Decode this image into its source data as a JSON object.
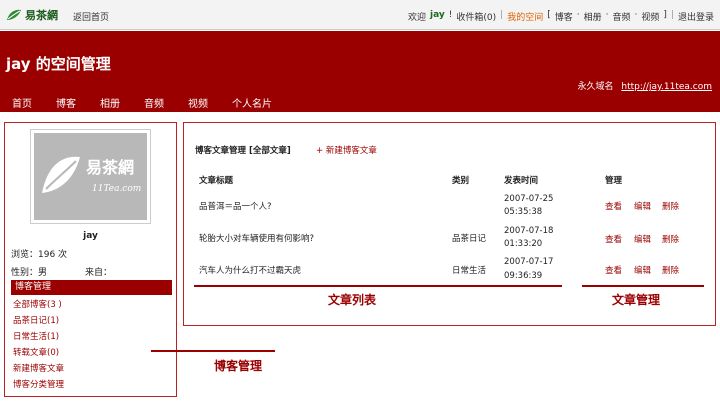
{
  "topbar": {
    "logo_text": "易茶網",
    "back_home": "返回首页",
    "welcome": "欢迎",
    "username": "jay",
    "exclaim": "!",
    "inbox": "收件箱(0)",
    "pipe": "|",
    "my_space": "我的空间",
    "bracket_open": "[",
    "links": [
      "博客",
      "相册",
      "音频",
      "视频"
    ],
    "dot": "·",
    "bracket_close": "]",
    "logout": "退出登录"
  },
  "header": {
    "title": "jay 的空间管理",
    "permalink_label": "永久域名",
    "permalink_url": "http://jay.11tea.com",
    "nav": [
      "首页",
      "博客",
      "相册",
      "音频",
      "视频",
      "个人名片"
    ]
  },
  "sidebar": {
    "avatar_text": "易茶網",
    "avatar_sub": "11Tea.com",
    "name": "jay",
    "views": "浏览：196 次",
    "gender": "性别：男",
    "from": "来自：",
    "section_title": "博客管理",
    "items": [
      "全部博客(3 )",
      "品茶日记(1)",
      "日常生活(1)",
      "转载文章(0)",
      "新建博客文章",
      "博客分类管理"
    ]
  },
  "main": {
    "heading": "博客文章管理 [全部文章]",
    "new_post": "+ 新建博客文章",
    "columns": {
      "title": "文章标题",
      "category": "类别",
      "time": "发表时间",
      "manage": "管理"
    },
    "rows": [
      {
        "title": "品普洱＝品一个人?",
        "category": "",
        "date": "2007-07-25",
        "time": "05:35:38"
      },
      {
        "title": "轮胎大小对车辆使用有何影响?",
        "category": "品茶日记",
        "date": "2007-07-18",
        "time": "01:33:20"
      },
      {
        "title": "汽车人为什么打不过霸天虎",
        "category": "日常生活",
        "date": "2007-07-17",
        "time": "09:36:39"
      }
    ],
    "actions": {
      "view": "查看",
      "edit": "编辑",
      "delete": "删除"
    }
  },
  "annotations": {
    "article_list": "文章列表",
    "article_mgmt": "文章管理",
    "blog_mgmt": "博客管理"
  },
  "colors": {
    "brand_red": "#9b0000",
    "brand_green": "#1d5c1d"
  }
}
